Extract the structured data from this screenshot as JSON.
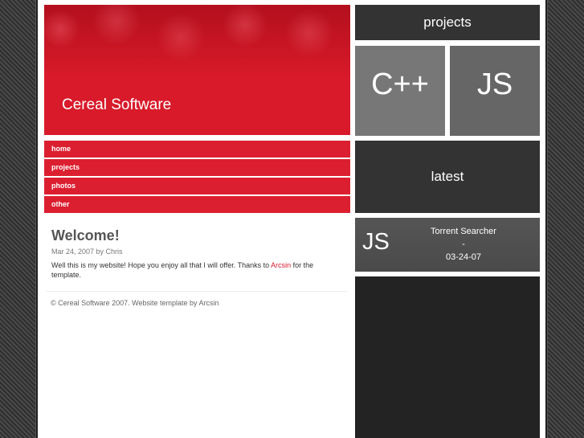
{
  "header": {
    "site_title": "Cereal Software"
  },
  "nav": {
    "items": [
      {
        "label": "home"
      },
      {
        "label": "projects"
      },
      {
        "label": "photos"
      },
      {
        "label": "other"
      }
    ]
  },
  "post": {
    "title": "Welcome!",
    "meta": "Mar 24, 2007 by Chris",
    "body_before": "Well this is my website! Hope you enjoy all that I will offer. Thanks to ",
    "body_link": "Arcsin",
    "body_after": " for the template."
  },
  "footer": {
    "text": "© Cereal Software 2007. Website template by Arcsin"
  },
  "sidebar": {
    "projects_title": "projects",
    "tiles": [
      {
        "label": "C++"
      },
      {
        "label": "JS"
      }
    ],
    "latest_title": "latest",
    "latest_item": {
      "icon_label": "JS",
      "name": "Torrent Searcher",
      "separator": "-",
      "date": "03-24-07"
    }
  },
  "colors": {
    "brand_red": "#d81a2a",
    "dark_panel": "#333333"
  }
}
